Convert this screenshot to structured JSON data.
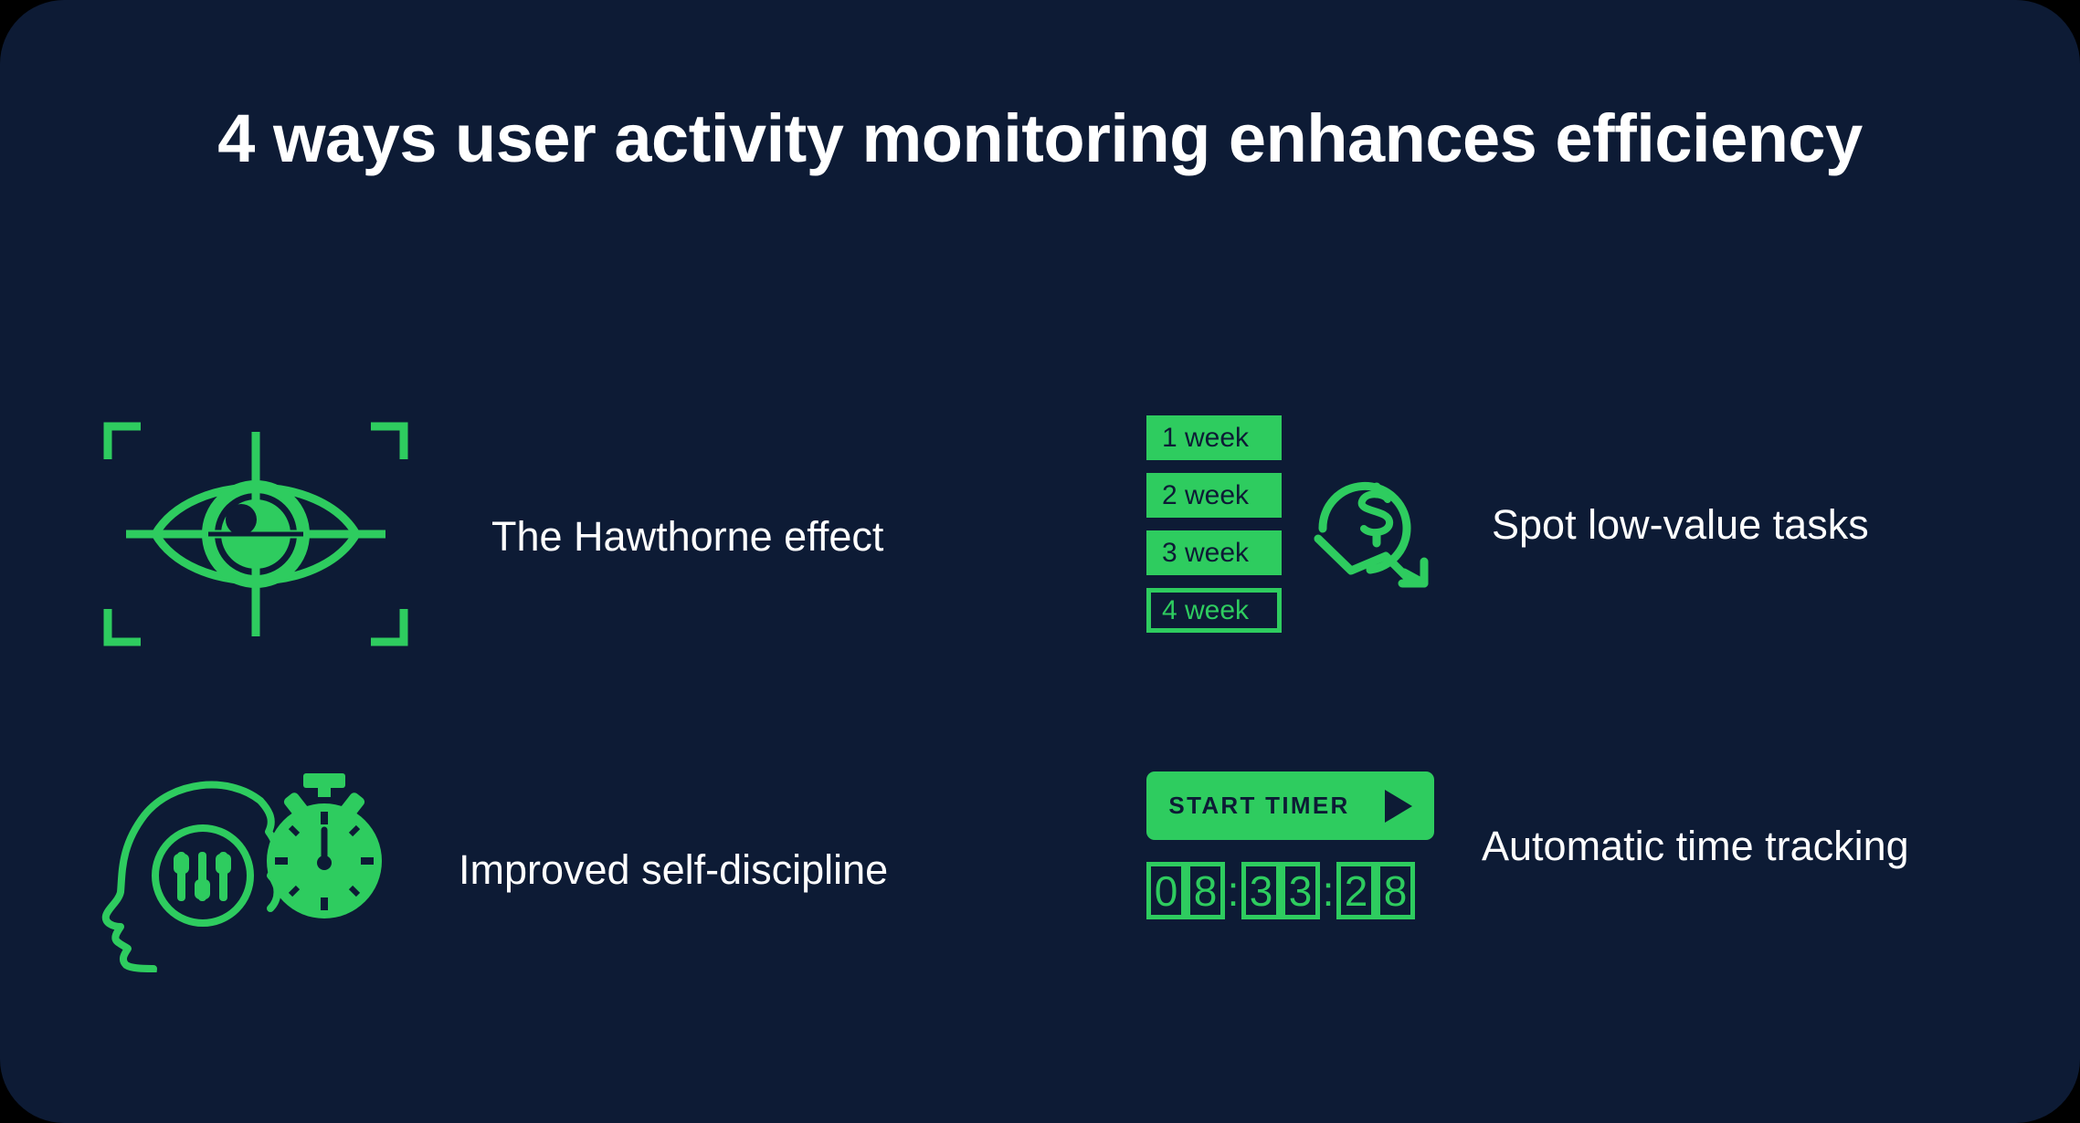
{
  "card": {
    "background_color": "#0d1b35",
    "accent_color": "#2ecc5f",
    "text_color": "#ffffff"
  },
  "header": {
    "title": "4 ways user activity monitoring enhances efficiency"
  },
  "items": [
    {
      "id": "hawthorne",
      "label": "The Hawthorne effect",
      "icon": "eye-target-icon"
    },
    {
      "id": "low-value-tasks",
      "label": "Spot low-value tasks",
      "icon": "money-decline-icon",
      "weeks": [
        {
          "label": "1 week",
          "style": "filled"
        },
        {
          "label": "2 week",
          "style": "filled"
        },
        {
          "label": "3 week",
          "style": "filled"
        },
        {
          "label": "4 week",
          "style": "outlined"
        }
      ]
    },
    {
      "id": "self-discipline",
      "label": "Improved self-discipline",
      "icon": "head-stopwatch-icon"
    },
    {
      "id": "time-tracking",
      "label": "Automatic time tracking",
      "icon": "timer-icon",
      "timer": {
        "button_label": "START TIMER",
        "play_icon": "play-icon",
        "digits": [
          "0",
          "8",
          "3",
          "3",
          "2",
          "8"
        ],
        "separator": ":",
        "display": "08:33:28"
      }
    }
  ]
}
